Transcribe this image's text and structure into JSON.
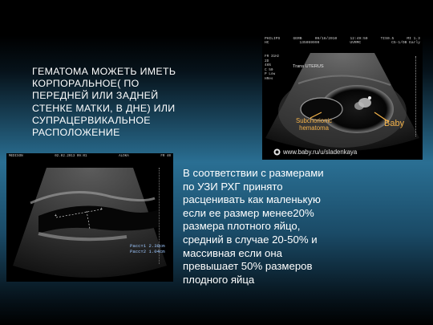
{
  "slide": {
    "title": "ГЕМАТОМА МОЖЕТЬ ИМЕТЬ\nКОРПОРАЛЬНОЕ( ПО\nПЕРЕДНЕЙ ИЛИ ЗАДНЕЙ\nСТЕНКЕ МАТКИ, В ДНЕ) ИЛИ\nСУПРАЦЕРВИКАЛЬНОЕ\nРАСПОЛОЖЕНИЕ",
    "body": "В соответствии с размерами\nпо УЗИ РХГ принято\nрасценивать как маленькую\nесли ее размер менее20%\nразмера плотного яйцо,\nсредний в случае 20-50% и\nмассивная если она\nпревышает 50% размеров\nплодного яйца"
  },
  "ultrasound_top": {
    "header_row1": [
      "PHILIPS",
      "GERB",
      "09/16/2010",
      "12:49:50",
      "TIS0.5",
      "MI 1.3"
    ],
    "header_row2": [
      "HC",
      "135059999",
      "UVRMC",
      "C5-1/OB Early"
    ],
    "side_info": "FR 31Hz\n2D\n46%\nC 50\nP Low\nHRes",
    "trans_label": "Trans  UTERUS",
    "annotation_hematoma": "Subchorionic\nhematoma",
    "annotation_baby": "Baby",
    "watermark": "www.baby.ru/u/sladenkaya"
  },
  "ultrasound_bottom": {
    "header_row1": [
      "MEDISON",
      "02.02.2013 09:01",
      "ALOKA",
      "FR 40"
    ],
    "header_row2": [
      "",
      "",
      "",
      ""
    ],
    "measurements": "Расст1 2.38cm\nРасст2 1.04cm"
  },
  "colors": {
    "text": "#ffffff",
    "annotation_orange": "#f3b24a",
    "background_blue": "#2a6f93"
  }
}
